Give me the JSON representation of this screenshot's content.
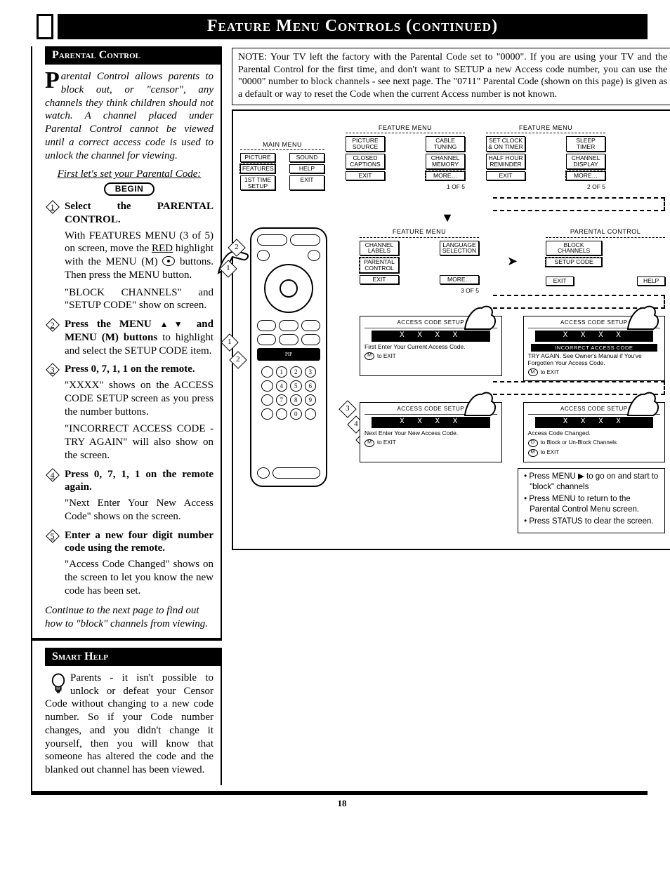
{
  "title": "Feature Menu Controls (continued)",
  "page_number": "18",
  "parental": {
    "header": "Parental Control",
    "intro_rest": "arental Control allows parents to block out, or \"censor\", any channels they think children should not watch. A channel placed under Parental Control cannot be viewed until a correct access code is used to unlock the channel for viewing.",
    "first_line": "First let's set your Parental Code:",
    "begin": "BEGIN",
    "steps": [
      {
        "n": "1",
        "head": "Select the PARENTAL CONTROL.",
        "body": "With FEATURES MENU (3 of 5) on screen, move the RED highlight with the MENU (M) buttons. Then press the MENU button.",
        "after": "\"BLOCK CHANNELS\" and \"SETUP CODE\" show on screen."
      },
      {
        "n": "2",
        "head": "Press the MENU ▲▼ and MENU (M) buttons",
        "body": "to highlight and select the SETUP CODE item.",
        "after": ""
      },
      {
        "n": "3",
        "head": "Press 0, 7, 1, 1 on the remote.",
        "body": "\"XXXX\" shows on the ACCESS CODE SETUP screen as you press the number buttons.",
        "after": "\"INCORRECT ACCESS CODE - TRY AGAIN\" will also show on the screen."
      },
      {
        "n": "4",
        "head": "Press 0, 7, 1, 1 on the remote again.",
        "body": "\"Next Enter Your New Access Code\" shows on the screen.",
        "after": ""
      },
      {
        "n": "5",
        "head": "Enter a new four digit number code using the remote.",
        "body": "\"Access Code Changed\" shows on the screen to let you know the new code has been set.",
        "after": ""
      }
    ],
    "continue": "Continue to the next page to find out how to \"block\" channels from viewing."
  },
  "smart": {
    "header": "Smart Help",
    "body": "Parents - it isn't possible to unlock or defeat your Censor Code without changing to a new code number. So if your Code number changes, and you didn't change it yourself, then you will know that someone has altered the code and the blanked out channel has been viewed."
  },
  "note": "NOTE: Your TV left the factory with the Parental Code set to \"0000\". If you are using your TV and the Parental Control for the first time, and don't want to SETUP a new Access code number, you can use the \"0000\" number to block channels - see next page. The \"0711\" Parental Code (shown on this page) is given as a default or way to reset the Code when the current Access number is not known.",
  "menus": {
    "main": {
      "title": "MAIN MENU",
      "cells": [
        "PICTURE",
        "SOUND",
        "FEATURES",
        "HELP",
        "1ST TIME SETUP",
        "EXIT"
      ]
    },
    "feature1": {
      "title": "FEATURE MENU",
      "cells": [
        "PICTURE SOURCE",
        "CABLE TUNING",
        "CLOSED CAPTIONS",
        "CHANNEL MEMORY",
        "EXIT",
        "MORE…"
      ],
      "foot": "1 OF 5"
    },
    "feature2": {
      "title": "FEATURE MENU",
      "cells": [
        "SET CLOCK & ON TIMER",
        "SLEEP TIMER",
        "HALF HOUR REMINDER",
        "CHANNEL DISPLAY",
        "EXIT",
        "MORE…"
      ],
      "foot": "2 OF 5"
    },
    "feature3": {
      "title": "FEATURE MENU",
      "cells": [
        "CHANNEL LABELS",
        "LANGUAGE SELECTION",
        "PARENTAL CONTROL",
        "",
        "EXIT",
        "MORE…"
      ],
      "foot": "3 OF 5"
    },
    "pcontrol": {
      "title": "PARENTAL CONTROL",
      "cells": [
        "BLOCK CHANNELS",
        "SETUP CODE",
        "EXIT",
        "HELP"
      ]
    }
  },
  "screens": {
    "title": "ACCESS CODE SETUP",
    "code": "X X X X",
    "s1_msg": "First Enter Your Current Access Code.",
    "s2_err": "INCORRECT ACCESS CODE",
    "s2_msg": "TRY AGAIN. See Owner's Manual if You've Forgotten Your Access Code.",
    "s3_msg": "Next Enter Your New Access Code.",
    "s4_msg1": "Access Code Changed.",
    "s4_msg2a": "to Block or Un-Block Channels",
    "exit": "to EXIT",
    "m": "M",
    "d": "D"
  },
  "tips": [
    "Press MENU ▶ to go on and start to \"block\" channels",
    "Press MENU to return to the Parental Control Menu screen.",
    "Press STATUS to clear the screen."
  ]
}
